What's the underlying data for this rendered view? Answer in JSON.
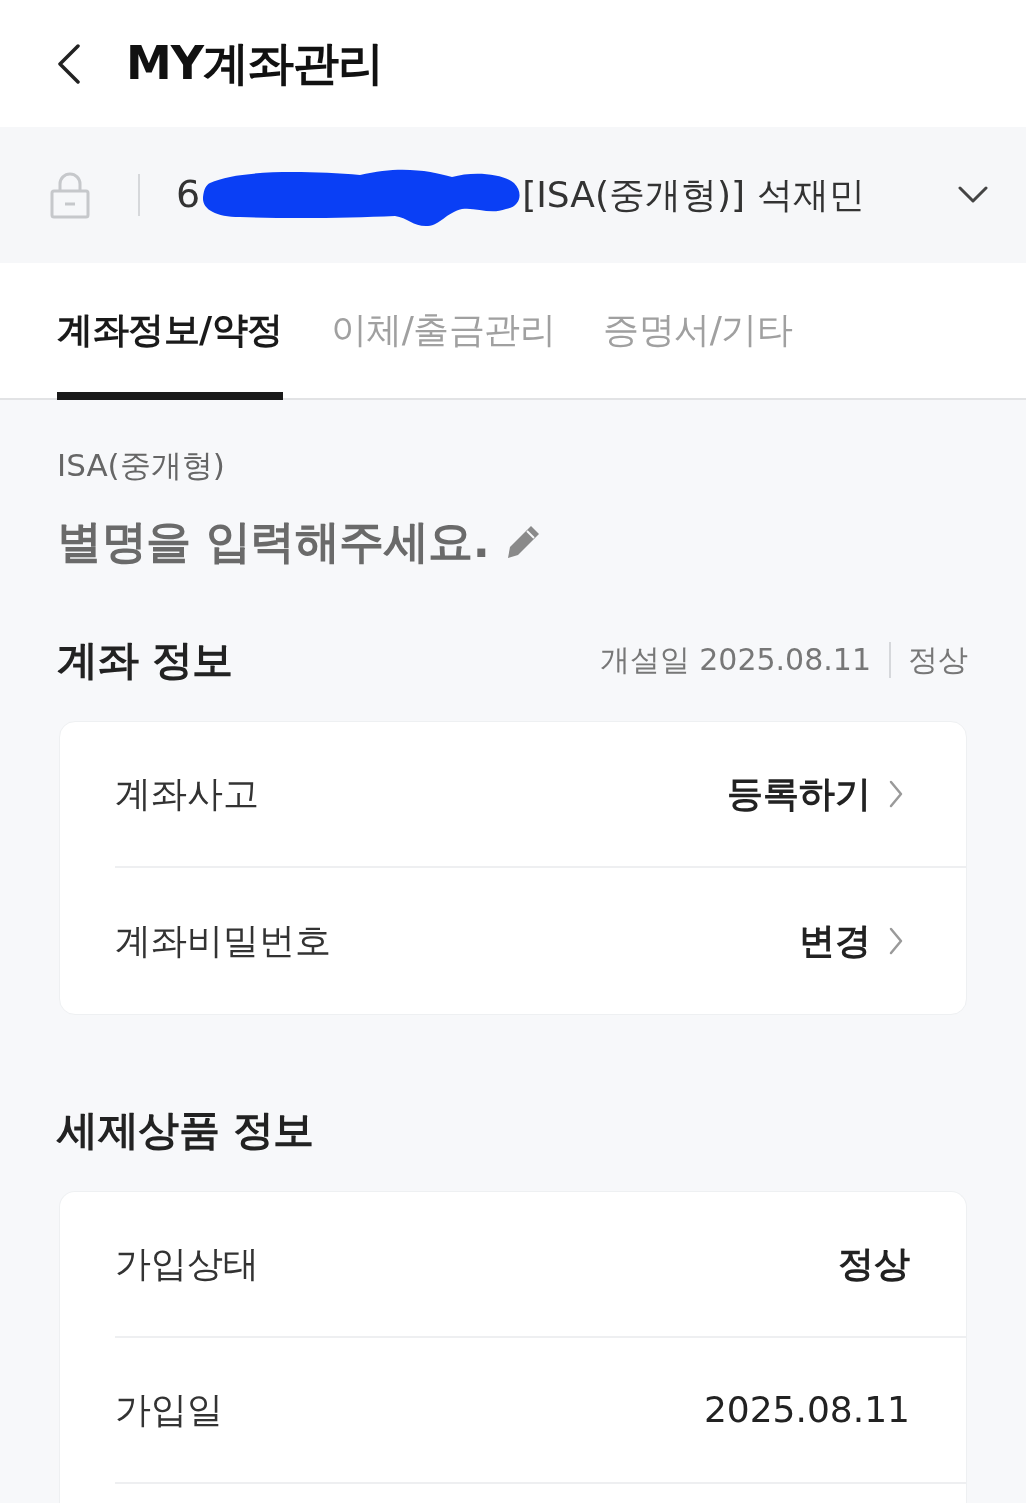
{
  "header": {
    "title": "MY계좌관리"
  },
  "account_selector": {
    "number_visible": "6",
    "name": "[ISA(중개형)] 석재민"
  },
  "tabs": [
    {
      "label": "계좌정보/약정",
      "selected": true
    },
    {
      "label": "이체/출금관리",
      "selected": false
    },
    {
      "label": "증명서/기타",
      "selected": false
    }
  ],
  "account": {
    "type": "ISA(중개형)",
    "nickname_prompt": "별명을 입력해주세요."
  },
  "sections": [
    {
      "title": "계좌 정보",
      "meta": {
        "opened": "개설일 2025.08.11",
        "status": "정상"
      },
      "rows": [
        {
          "kind": "link",
          "label": "계좌사고",
          "value": "등록하기"
        },
        {
          "kind": "link",
          "label": "계좌비밀번호",
          "value": "변경"
        }
      ]
    },
    {
      "title": "세제상품 정보",
      "rows": [
        {
          "kind": "strong",
          "label": "가입상태",
          "value": "정상"
        },
        {
          "kind": "plain",
          "label": "가입일",
          "value": "2025.08.11"
        }
      ]
    }
  ]
}
